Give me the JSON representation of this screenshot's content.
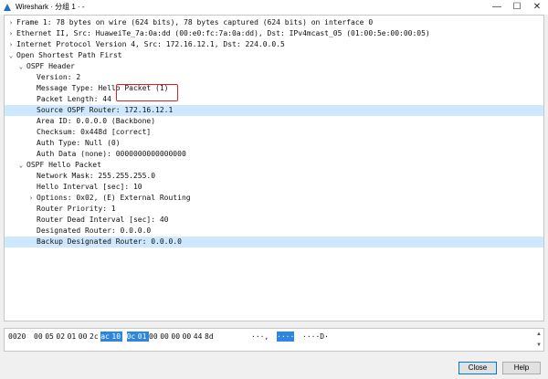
{
  "window": {
    "title": "Wireshark · 分组 1 · -",
    "minimize_glyph": "—",
    "maximize_glyph": "☐",
    "close_glyph": "✕"
  },
  "tree": [
    {
      "text": "Frame 1: 78 bytes on wire (624 bits), 78 bytes captured (624 bits) on interface 0",
      "depth": 0,
      "arrow": "›",
      "selected": false
    },
    {
      "text": "Ethernet II, Src: HuaweiTe_7a:0a:dd (00:e0:fc:7a:0a:dd), Dst: IPv4mcast_05 (01:00:5e:00:00:05)",
      "depth": 0,
      "arrow": "›",
      "selected": false
    },
    {
      "text": "Internet Protocol Version 4, Src: 172.16.12.1, Dst: 224.0.0.5",
      "depth": 0,
      "arrow": "›",
      "selected": false
    },
    {
      "text": "Open Shortest Path First",
      "depth": 0,
      "arrow": "⌄",
      "selected": false
    },
    {
      "text": "OSPF Header",
      "depth": 1,
      "arrow": "⌄",
      "selected": false
    },
    {
      "text": "Version: 2",
      "depth": 2,
      "arrow": "",
      "selected": false
    },
    {
      "text": "Message Type: Hello Packet (1)",
      "depth": 2,
      "arrow": "",
      "selected": false
    },
    {
      "text": "Packet Length: 44",
      "depth": 2,
      "arrow": "",
      "selected": false
    },
    {
      "text": "Source OSPF Router: 172.16.12.1",
      "depth": 2,
      "arrow": "",
      "selected": true
    },
    {
      "text": "Area ID: 0.0.0.0 (Backbone)",
      "depth": 2,
      "arrow": "",
      "selected": false
    },
    {
      "text": "Checksum: 0x448d [correct]",
      "depth": 2,
      "arrow": "",
      "selected": false
    },
    {
      "text": "Auth Type: Null (0)",
      "depth": 2,
      "arrow": "",
      "selected": false
    },
    {
      "text": "Auth Data (none): 0000000000000000",
      "depth": 2,
      "arrow": "",
      "selected": false
    },
    {
      "text": "OSPF Hello Packet",
      "depth": 1,
      "arrow": "⌄",
      "selected": false
    },
    {
      "text": "Network Mask: 255.255.255.0",
      "depth": 2,
      "arrow": "",
      "selected": false
    },
    {
      "text": "Hello Interval [sec]: 10",
      "depth": 2,
      "arrow": "",
      "selected": false
    },
    {
      "text": "Options: 0x02, (E) External Routing",
      "depth": 2,
      "arrow": "›",
      "selected": false
    },
    {
      "text": "Router Priority: 1",
      "depth": 2,
      "arrow": "",
      "selected": false
    },
    {
      "text": "Router Dead Interval [sec]: 40",
      "depth": 2,
      "arrow": "",
      "selected": false
    },
    {
      "text": "Designated Router: 0.0.0.0",
      "depth": 2,
      "arrow": "",
      "selected": false
    },
    {
      "text": "Backup Designated Router: 0.0.0.0",
      "depth": 2,
      "arrow": "",
      "selected": true
    }
  ],
  "hex": {
    "offset": "0020",
    "bytes": [
      {
        "v": "00",
        "hl": false
      },
      {
        "v": "05",
        "hl": false
      },
      {
        "v": "02",
        "hl": false
      },
      {
        "v": "01",
        "hl": false
      },
      {
        "v": "00",
        "hl": false
      },
      {
        "v": "2c",
        "hl": false
      },
      {
        "v": "ac",
        "hl": true
      },
      {
        "v": "10",
        "hl": true
      },
      {
        "v": "0c",
        "hl": true
      },
      {
        "v": "01",
        "hl": true
      },
      {
        "v": "00",
        "hl": false
      },
      {
        "v": "00",
        "hl": false
      },
      {
        "v": "00",
        "hl": false
      },
      {
        "v": "00",
        "hl": false
      },
      {
        "v": "44",
        "hl": false
      },
      {
        "v": "8d",
        "hl": false
      }
    ],
    "ascii_before": "···,",
    "ascii_highlight": "····",
    "ascii_after": "····D·",
    "scroll_up_glyph": "▲",
    "scroll_down_glyph": "▼"
  },
  "buttons": {
    "close_label": "Close",
    "help_label": "Help"
  },
  "colors": {
    "selection": "#cde8ff",
    "hex_highlight": "#2e86e0",
    "annotation": "#e02020"
  }
}
